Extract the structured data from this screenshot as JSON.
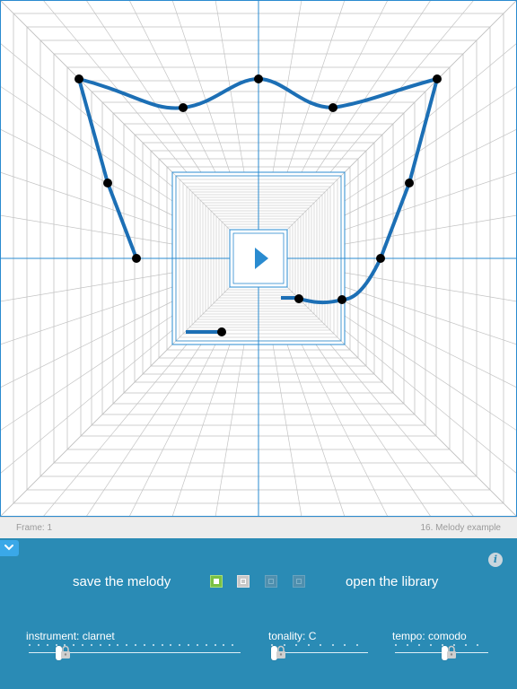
{
  "canvas": {
    "grid_color": "#c4c4c4",
    "axis_color": "#2a8bd0",
    "curve_color": "#1c6fb5",
    "point_color": "#000000",
    "play_label": "play-icon"
  },
  "status": {
    "frame": "Frame: 1",
    "title": "16. Melody example"
  },
  "panel": {
    "background": "#2a8bb5",
    "collapse_icon": "chevron-down-icon",
    "info_label": "i",
    "save_label": "save the melody",
    "open_label": "open the library",
    "slots": [
      {
        "state": "selected",
        "color": "#7ac143"
      },
      {
        "state": "filled",
        "color": "#c8c8c8"
      },
      {
        "state": "empty",
        "color": "#4f8fae"
      },
      {
        "state": "empty",
        "color": "#4f8fae"
      }
    ],
    "sliders": [
      {
        "label": "instrument: clarnet",
        "ticks": 24,
        "value_tick": 3,
        "lock_icon": "padlock-icon"
      },
      {
        "label": "tonality: C",
        "ticks": 8,
        "value_tick": 0,
        "lock_icon": "padlock-icon"
      },
      {
        "label": "tempo: comodo",
        "ticks": 8,
        "value_tick": 4,
        "lock_icon": "padlock-icon"
      }
    ]
  }
}
